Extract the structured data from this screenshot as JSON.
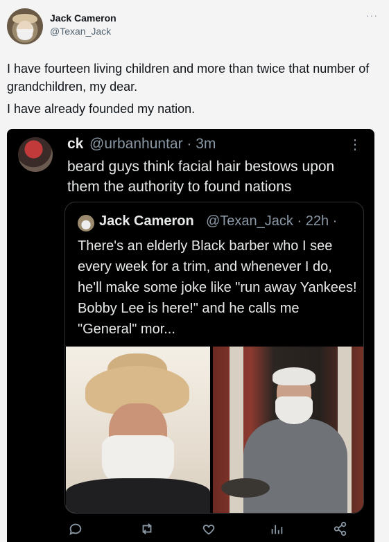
{
  "tweet": {
    "author": {
      "display_name": "Jack Cameron",
      "handle": "@Texan_Jack"
    },
    "text_line1": "I have fourteen living children and more than twice that number of grandchildren, my dear.",
    "text_line2": "I have already founded my nation."
  },
  "quoted": {
    "author": {
      "display_name": "ck",
      "handle_time": "@urbanhuntar · 3m"
    },
    "text": "beard guys think facial hair bestows upon them the authority to found nations",
    "inner": {
      "author": {
        "display_name": "Jack Cameron",
        "handle_time": "@Texan_Jack · 22h ·"
      },
      "text": "There's an elderly Black barber who I see every week for a trim, and whenever I do, he'll make some joke like \"run away Yankees! Bobby Lee is here!\" and he calls me \"General\" mor..."
    }
  },
  "actions": {
    "items": [
      {
        "name": "reply-icon"
      },
      {
        "name": "retweet-icon"
      },
      {
        "name": "like-icon"
      },
      {
        "name": "views-icon"
      },
      {
        "name": "share-icon"
      }
    ],
    "color": "#8b98a5"
  },
  "colors": {
    "background": "#f4f4f4",
    "card": "#000000",
    "muted": "#8b98a5",
    "text_dark": "#e7e9ea"
  }
}
